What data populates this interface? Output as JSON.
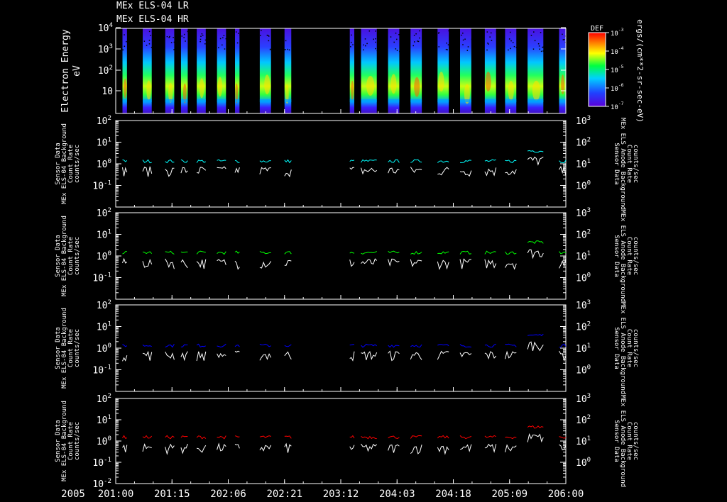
{
  "titles": [
    "MEx ELS-04 LR",
    "MEx ELS-04 HR"
  ],
  "chart_data": [
    {
      "type": "heatmap",
      "title": "",
      "ylabel": "Electron Energy",
      "yunit": "eV",
      "yscale": "log",
      "yticks": [
        "10",
        "10^2",
        "10^3",
        "10^4"
      ],
      "colorbar": {
        "label": "DEF",
        "unit": "ergs/(cm**2-sr-sec-eV)",
        "ticks": [
          "10^-3",
          "10^-4",
          "10^-5",
          "10^-6",
          "10^-7"
        ]
      },
      "data_bursts": [
        [
          0.015,
          0.025
        ],
        [
          0.06,
          0.08
        ],
        [
          0.11,
          0.13
        ],
        [
          0.145,
          0.16
        ],
        [
          0.18,
          0.2
        ],
        [
          0.225,
          0.245
        ],
        [
          0.265,
          0.275
        ],
        [
          0.32,
          0.345
        ],
        [
          0.375,
          0.39
        ],
        [
          0.52,
          0.53
        ],
        [
          0.545,
          0.58
        ],
        [
          0.605,
          0.63
        ],
        [
          0.655,
          0.68
        ],
        [
          0.715,
          0.74
        ],
        [
          0.765,
          0.79
        ],
        [
          0.82,
          0.845
        ],
        [
          0.865,
          0.89
        ],
        [
          0.915,
          0.95
        ],
        [
          0.985,
          1.0
        ]
      ]
    },
    {
      "type": "line",
      "left_label": [
        "Sensor Data",
        "MEx ELS-04 Background",
        "Count Rate",
        "counts/sec"
      ],
      "right_label": [
        "Sensor Data",
        "MEx ELS Anode Background",
        "Count Rate",
        "counts/sec"
      ],
      "left_ylim": [
        0.01,
        100
      ],
      "right_ylim": [
        0.1,
        1000
      ],
      "left_ticks": [
        "10^-1",
        "10^0",
        "10^1",
        "10^2"
      ],
      "right_ticks": [
        "10^0",
        "10^1",
        "10^2",
        "10^3"
      ],
      "series": [
        {
          "color": "#00ffff",
          "level": 1.3
        },
        {
          "color": "#ffffff",
          "level": 0.55
        }
      ]
    },
    {
      "type": "line",
      "left_label": [
        "Sensor Data",
        "MEx ELS-04 Background",
        "Count Rate",
        "counts/sec"
      ],
      "right_label": [
        "Sensor Data",
        "MEx ELS Anode Background",
        "Count Rate",
        "counts/sec"
      ],
      "left_ylim": [
        0.01,
        100
      ],
      "right_ylim": [
        0.1,
        1000
      ],
      "left_ticks": [
        "10^-1",
        "10^0",
        "10^1",
        "10^2"
      ],
      "right_ticks": [
        "10^0",
        "10^1",
        "10^2",
        "10^3"
      ],
      "series": [
        {
          "color": "#00ff00",
          "level": 1.4
        },
        {
          "color": "#ffffff",
          "level": 0.55
        }
      ]
    },
    {
      "type": "line",
      "left_label": [
        "Sensor Data",
        "MEx ELS-04 Background",
        "Count Rate",
        "counts/sec"
      ],
      "right_label": [
        "Sensor Data",
        "MEx ELS Anode Background",
        "Count Rate",
        "counts/sec"
      ],
      "left_ylim": [
        0.01,
        100
      ],
      "right_ylim": [
        0.1,
        1000
      ],
      "left_ticks": [
        "10^-1",
        "10^0",
        "10^1",
        "10^2"
      ],
      "right_ticks": [
        "10^0",
        "10^1",
        "10^2",
        "10^3"
      ],
      "series": [
        {
          "color": "#0000ff",
          "level": 1.3
        },
        {
          "color": "#ffffff",
          "level": 0.55
        }
      ]
    },
    {
      "type": "line",
      "left_label": [
        "Sensor Data",
        "MEx ELS-04 Background",
        "Count Rate",
        "counts/sec"
      ],
      "right_label": [
        "Sensor Data",
        "MEx ELS Anode Background",
        "Count Rate",
        "counts/sec"
      ],
      "left_ylim": [
        0.01,
        100
      ],
      "right_ylim": [
        0.1,
        1000
      ],
      "left_ticks": [
        "10^-2",
        "10^-1",
        "10^0",
        "10^1",
        "10^2"
      ],
      "right_ticks": [
        "10^0",
        "10^1",
        "10^2",
        "10^3"
      ],
      "series": [
        {
          "color": "#ff0000",
          "level": 1.5
        },
        {
          "color": "#ffffff",
          "level": 0.55
        }
      ]
    }
  ],
  "xaxis": {
    "year": "2005",
    "ticks": [
      "201:00",
      "201:15",
      "202:06",
      "202:21",
      "203:12",
      "204:03",
      "204:18",
      "205:09",
      "206:00"
    ]
  },
  "colors": {
    "background": "#000000",
    "axes": "#ffffff",
    "cyan": "#00ffff",
    "green": "#00ff00",
    "blue": "#0000ff",
    "red": "#ff0000"
  }
}
